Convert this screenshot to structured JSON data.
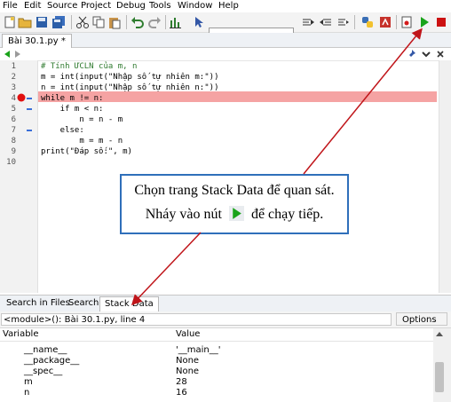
{
  "menu": [
    "File",
    "Edit",
    "Source",
    "Project",
    "Debug",
    "Tools",
    "Window",
    "Help"
  ],
  "toolbar": {
    "icons": [
      "new-file-icon",
      "open-folder-icon",
      "save-icon",
      "save-all-icon",
      "close-icon",
      "cut-icon",
      "copy-icon",
      "paste-icon",
      "undo-icon",
      "redo-icon",
      "stats-icon",
      "more-icon",
      "pointer-icon",
      "search-icon",
      "find-next-icon",
      "find-prev-icon",
      "replace-icon",
      "python-icon",
      "package-icon",
      "debug-icon",
      "run-icon",
      "stop-icon"
    ],
    "search_value": ""
  },
  "editor": {
    "tab_label": "Bài 30.1.py *",
    "lines": [
      {
        "num": "1",
        "text": "# Tính ƯCLN của m, n"
      },
      {
        "num": "2",
        "text": "m = int(input(\"Nhập số tự nhiên m:\"))"
      },
      {
        "num": "3",
        "text": "n = int(input(\"Nhập số tự nhiên n:\"))"
      },
      {
        "num": "4",
        "text": "while m != n:"
      },
      {
        "num": "5",
        "text": "    if m < n:"
      },
      {
        "num": "6",
        "text": "        n = n - m"
      },
      {
        "num": "7",
        "text": "    else:"
      },
      {
        "num": "8",
        "text": "        m = m - n"
      },
      {
        "num": "9",
        "text": "print(\"Đáp số:\", m)"
      },
      {
        "num": "10",
        "text": ""
      }
    ]
  },
  "callout": {
    "line1": "Chọn trang Stack Data để quan sát.",
    "line2_before": "Nháy vào nút",
    "line2_after": "để chạy tiếp."
  },
  "bottom_tabs": [
    "Search in Files",
    "Search",
    "Stack Data"
  ],
  "stack": {
    "module_label": "<module>(): Bài 30.1.py, line 4",
    "options_label": "Options",
    "col_variable": "Variable",
    "col_value": "Value",
    "rows": [
      {
        "name": "__name__",
        "value": "'__main__'"
      },
      {
        "name": "__package__",
        "value": "None"
      },
      {
        "name": "__spec__",
        "value": "None"
      },
      {
        "name": "m",
        "value": "28"
      },
      {
        "name": "n",
        "value": "16"
      }
    ]
  },
  "colors": {
    "breakpoint": "#e11010",
    "highlight": "#f5a3a3",
    "arrow": "#c0151a",
    "callout_border": "#2f6fba",
    "run_green": "#1aa31a",
    "stop_red": "#cc1111"
  }
}
